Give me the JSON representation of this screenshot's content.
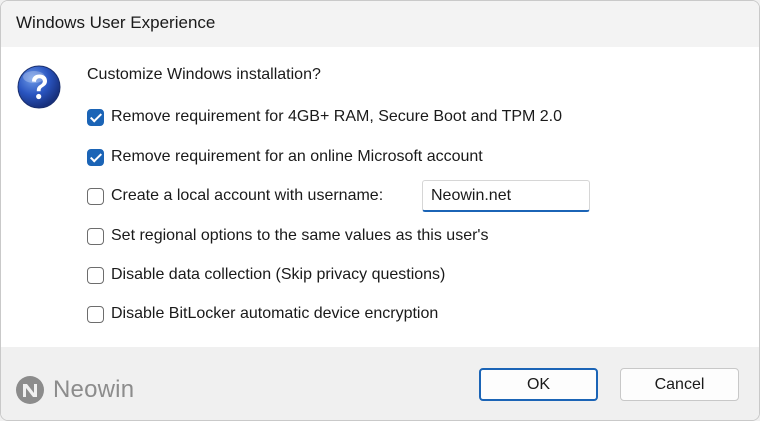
{
  "window": {
    "title": "Windows User Experience"
  },
  "dialog": {
    "prompt": "Customize Windows installation?",
    "icon": "question-icon",
    "options": [
      {
        "label": "Remove requirement for 4GB+ RAM, Secure Boot and TPM 2.0",
        "checked": true
      },
      {
        "label": "Remove requirement for an online Microsoft account",
        "checked": true
      },
      {
        "label": "Create a local account with username:",
        "checked": false
      },
      {
        "label": "Set regional options to the same values as this user's",
        "checked": false
      },
      {
        "label": "Disable data collection (Skip privacy questions)",
        "checked": false
      },
      {
        "label": "Disable BitLocker automatic device encryption",
        "checked": false
      }
    ],
    "username_value": "Neowin.net"
  },
  "buttons": {
    "ok_label": "OK",
    "cancel_label": "Cancel"
  },
  "watermark": {
    "text": "Neowin"
  },
  "colors": {
    "accent": "#1b64b6",
    "footer": "#f0f0f0",
    "titlebar": "#f3f3f3"
  }
}
